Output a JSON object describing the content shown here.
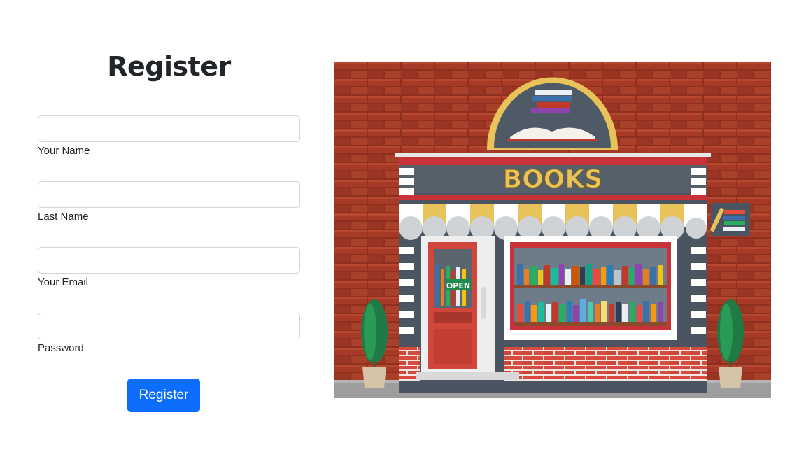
{
  "form": {
    "title": "Register",
    "fields": [
      {
        "label": "Your Name",
        "value": "",
        "placeholder": "",
        "type": "text"
      },
      {
        "label": "Last Name",
        "value": "",
        "placeholder": "",
        "type": "text"
      },
      {
        "label": "Your Email",
        "value": "",
        "placeholder": "",
        "type": "email"
      },
      {
        "label": "Password",
        "value": "",
        "placeholder": "",
        "type": "password"
      }
    ],
    "submit_label": "Register",
    "accent_color": "#0d6efd"
  },
  "illustration": {
    "sign_text": "BOOKS",
    "door_sign": "OPEN",
    "colors": {
      "brick": "#a63a26",
      "sign_gold": "#e8c35a",
      "door_red": "#d2453b",
      "plant_green": "#1f7a45"
    }
  }
}
